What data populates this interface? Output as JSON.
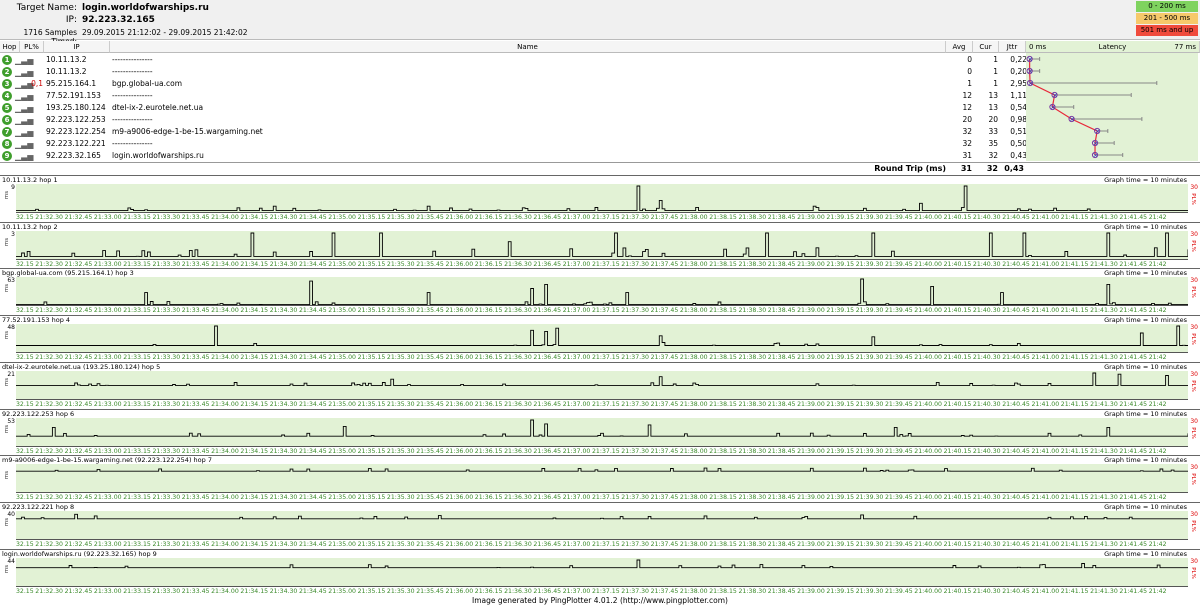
{
  "header": {
    "target_label": "Target Name:",
    "target_value": "login.worldofwarships.ru",
    "ip_label": "IP:",
    "ip_value": "92.223.32.165",
    "samples_label": "1716 Samples Timed:",
    "samples_value": "29.09.2015 21:12:02 - 29.09.2015 21:42:02"
  },
  "legend": [
    {
      "label": "0 - 200 ms",
      "color": "#7fd35f"
    },
    {
      "label": "201 - 500 ms",
      "color": "#f6c96b"
    },
    {
      "label": "501 ms and up",
      "color": "#f04b3c"
    }
  ],
  "columns": {
    "hop": "Hop",
    "pl": "PL%",
    "ip": "IP",
    "name": "Name",
    "avg": "Avg",
    "cur": "Cur",
    "jitter": "Jttr",
    "lat_min": "0 ms",
    "lat_title": "Latency",
    "lat_max": "77 ms"
  },
  "hops": [
    {
      "num": "1",
      "pl": "",
      "ip": "10.11.13.2",
      "name": "---------------",
      "avg": "0",
      "cur": "1",
      "jitter": "0,22",
      "avg_ms": 0.3,
      "max_ms": 5
    },
    {
      "num": "2",
      "pl": "",
      "ip": "10.11.13.2",
      "name": "---------------",
      "avg": "0",
      "cur": "1",
      "jitter": "0,20",
      "avg_ms": 0.3,
      "max_ms": 5
    },
    {
      "num": "3",
      "pl": "0,1",
      "ip": "95.215.164.1",
      "name": "bgp.global-ua.com",
      "avg": "1",
      "cur": "1",
      "jitter": "2,95",
      "avg_ms": 0.5,
      "max_ms": 60
    },
    {
      "num": "4",
      "pl": "",
      "ip": "77.52.191.153",
      "name": "---------------",
      "avg": "12",
      "cur": "13",
      "jitter": "1,11",
      "avg_ms": 12,
      "max_ms": 48
    },
    {
      "num": "5",
      "pl": "",
      "ip": "193.25.180.124",
      "name": "dtel-ix-2.eurotele.net.ua",
      "avg": "12",
      "cur": "13",
      "jitter": "0,54",
      "avg_ms": 11,
      "max_ms": 21
    },
    {
      "num": "6",
      "pl": "",
      "ip": "92.223.122.253",
      "name": "---------------",
      "avg": "20",
      "cur": "20",
      "jitter": "0,98",
      "avg_ms": 20,
      "max_ms": 53
    },
    {
      "num": "7",
      "pl": "",
      "ip": "92.223.122.254",
      "name": "m9-a9006-edge-1-be-15.wargaming.net",
      "avg": "32",
      "cur": "33",
      "jitter": "0,51",
      "avg_ms": 32,
      "max_ms": 37
    },
    {
      "num": "8",
      "pl": "",
      "ip": "92.223.122.221",
      "name": "---------------",
      "avg": "32",
      "cur": "35",
      "jitter": "0,50",
      "avg_ms": 31,
      "max_ms": 40
    },
    {
      "num": "9",
      "pl": "",
      "ip": "92.223.32.165",
      "name": "login.worldofwarships.ru",
      "avg": "31",
      "cur": "32",
      "jitter": "0,43",
      "avg_ms": 31,
      "max_ms": 44
    }
  ],
  "round_trip": {
    "label": "Round Trip (ms)",
    "avg": "31",
    "cur": "32",
    "jitter": "0,43"
  },
  "graph_time": "Graph time = 10 minutes",
  "pl_axis_max": "30",
  "pl_axis_label": "PL%",
  "ms_axis_label": "ms",
  "time_ticks": [
    "21:32.15",
    "21:32.30",
    "21:32.45",
    "21:33.00",
    "21:33.15",
    "21:33.30",
    "21:33.45",
    "21:34.00",
    "21:34.15",
    "21:34.30",
    "21:34.45",
    "21:35.00",
    "21:35.15",
    "21:35.30",
    "21:35.45",
    "21:36.00",
    "21:36.15",
    "21:36.30",
    "21:36.45",
    "21:37.00",
    "21:37.15",
    "21:37.30",
    "21:37.45",
    "21:38.00",
    "21:38.15",
    "21:38.30",
    "21:38.45",
    "21:39.00",
    "21:39.15",
    "21:39.30",
    "21:39.45",
    "21:40.00",
    "21:40.15",
    "21:40.30",
    "21:40.45",
    "21:41.00",
    "21:41.15",
    "21:41.30",
    "21:41.45",
    "21:42"
  ],
  "graphs": [
    {
      "title": "10.11.13.2 hop 1",
      "ymax": "9",
      "base": 0.5,
      "spikes": [
        [
          0.53,
          9
        ],
        [
          0.81,
          9
        ],
        [
          0.55,
          4
        ],
        [
          0.22,
          2
        ],
        [
          0.35,
          2
        ],
        [
          0.68,
          2
        ],
        [
          0.77,
          3
        ]
      ]
    },
    {
      "title": "10.11.13.2 hop 2",
      "ymax": "3",
      "base": 0.3,
      "spikes": [
        [
          0.2,
          3
        ],
        [
          0.27,
          3
        ],
        [
          0.31,
          3
        ],
        [
          0.42,
          2
        ],
        [
          0.51,
          3
        ],
        [
          0.64,
          3
        ],
        [
          0.73,
          3
        ],
        [
          0.83,
          3
        ],
        [
          0.86,
          3
        ],
        [
          0.93,
          3
        ],
        [
          0.98,
          3
        ]
      ]
    },
    {
      "title": "bgp.global-ua.com (95.215.164.1) hop 3",
      "ymax": "63",
      "base": 1,
      "spikes": [
        [
          0.11,
          30
        ],
        [
          0.25,
          58
        ],
        [
          0.35,
          30
        ],
        [
          0.44,
          40
        ],
        [
          0.45,
          50
        ],
        [
          0.52,
          30
        ],
        [
          0.72,
          63
        ],
        [
          0.78,
          45
        ],
        [
          0.93,
          50
        ],
        [
          0.84,
          30
        ]
      ]
    },
    {
      "title": "77.52.191.153 hop 4",
      "ymax": "48",
      "base": 12,
      "spikes": [
        [
          0.17,
          48
        ],
        [
          0.44,
          40
        ],
        [
          0.45,
          38
        ],
        [
          0.46,
          44
        ],
        [
          0.55,
          30
        ],
        [
          0.73,
          28
        ],
        [
          0.96,
          35
        ],
        [
          0.99,
          48
        ]
      ]
    },
    {
      "title": "dtel-ix-2.eurotele.net.ua (193.25.180.124) hop 5",
      "ymax": "21",
      "base": 11,
      "spikes": [
        [
          0.55,
          18
        ],
        [
          0.92,
          21
        ],
        [
          0.94,
          20
        ],
        [
          0.98,
          19
        ],
        [
          0.32,
          16
        ]
      ]
    },
    {
      "title": "92.223.122.253 hop 6",
      "ymax": "53",
      "base": 20,
      "spikes": [
        [
          0.03,
          38
        ],
        [
          0.28,
          40
        ],
        [
          0.44,
          53
        ],
        [
          0.45,
          45
        ],
        [
          0.54,
          43
        ],
        [
          0.75,
          38
        ],
        [
          0.93,
          38
        ]
      ]
    },
    {
      "title": "m9-a9006-edge-1-be-15.wargaming.net (92.223.122.254) hop 7",
      "ymax": "",
      "base": 32,
      "spikes": [
        [
          0.3,
          36
        ],
        [
          0.6,
          36
        ]
      ]
    },
    {
      "title": "92.223.122.221 hop 8",
      "ymax": "40",
      "base": 31,
      "spikes": [
        [
          0.05,
          38
        ],
        [
          0.36,
          36
        ],
        [
          0.72,
          37
        ]
      ]
    },
    {
      "title": "login.worldofwarships.ru (92.223.32.165) hop 9",
      "ymax": "44",
      "base": 31,
      "spikes": [
        [
          0.53,
          44
        ],
        [
          0.3,
          36
        ],
        [
          0.91,
          38
        ]
      ]
    }
  ],
  "footer": "Image generated by PingPlotter 4.01.2 (http://www.pingplotter.com)"
}
